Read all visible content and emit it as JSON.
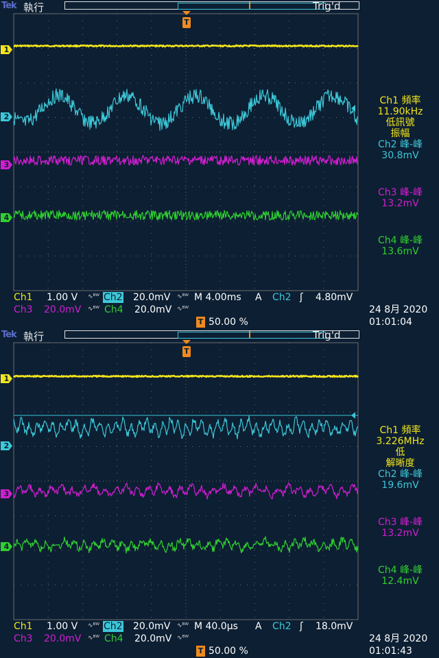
{
  "colors": {
    "ch1": "#f2e51c",
    "ch2": "#3cc8d8",
    "ch3": "#d21ed2",
    "ch4": "#30d030",
    "trigger": "#f08a1e",
    "background": "#0d1f33",
    "grid": "#6d6d6d"
  },
  "icons": {
    "trigger_marker": "T-marker",
    "slope": "rising-edge-icon",
    "coupling": "bandwidth-limit-icon"
  },
  "screens": [
    {
      "brand": "Tek",
      "run_state": "執行",
      "trig_state": "Trig'd",
      "trigger_marker": "T",
      "channel_markers": [
        "1",
        "2",
        "3",
        "4"
      ],
      "measurements": {
        "ch1_line1": "Ch1 頻率",
        "ch1_line2": "11.90kHz",
        "ch1_line3": "低訊號",
        "ch1_line4": "振幅",
        "ch2_title": "Ch2 峰-峰",
        "ch2_value": "30.8mV",
        "ch3_title": "Ch3 峰-峰",
        "ch3_value": "13.2mV",
        "ch4_title": "Ch4 峰-峰",
        "ch4_value": "13.6mV"
      },
      "bottom": {
        "ch1_label": "Ch1",
        "ch1_scale": "1.00 V",
        "ch2_label": "Ch2",
        "ch2_scale": "20.0mV",
        "ch3_label": "Ch3",
        "ch3_scale": "20.0mV",
        "ch4_label": "Ch4",
        "ch4_scale": "20.0mV",
        "timebase": "M 4.00ms",
        "trig_mode": "A",
        "trig_source": "Ch2",
        "trig_level": "4.80mV",
        "trig_pos": "50.00 %",
        "date": "24 8月  2020",
        "time": "01:01:04"
      }
    },
    {
      "brand": "Tek",
      "run_state": "執行",
      "trig_state": "Trig'd",
      "trigger_marker": "T",
      "channel_markers": [
        "1",
        "2",
        "3",
        "4"
      ],
      "measurements": {
        "ch1_line1": "Ch1 頻率",
        "ch1_line2": "3.226MHz",
        "ch1_line3": "低",
        "ch1_line4": "解晰度",
        "ch2_title": "Ch2 峰-峰",
        "ch2_value": "19.6mV",
        "ch3_title": "Ch3 峰-峰",
        "ch3_value": "13.2mV",
        "ch4_title": "Ch4 峰-峰",
        "ch4_value": "12.4mV"
      },
      "bottom": {
        "ch1_label": "Ch1",
        "ch1_scale": "1.00 V",
        "ch2_label": "Ch2",
        "ch2_scale": "20.0mV",
        "ch3_label": "Ch3",
        "ch3_scale": "20.0mV",
        "ch4_label": "Ch4",
        "ch4_scale": "20.0mV",
        "timebase": "M 40.0µs",
        "trig_mode": "A",
        "trig_source": "Ch2",
        "trig_level": "18.0mV",
        "trig_pos": "50.00 %",
        "date": "24 8月  2020",
        "time": "01:01:43"
      }
    }
  ]
}
